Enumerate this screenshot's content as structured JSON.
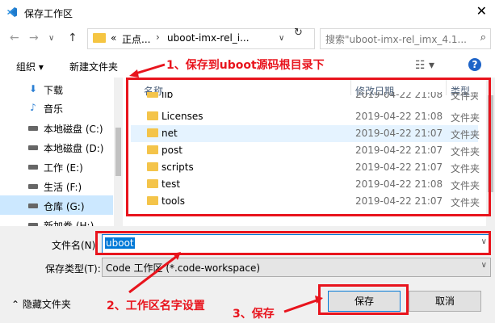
{
  "window": {
    "title": "保存工作区",
    "close_glyph": "✕",
    "app_icon": "vscode-icon"
  },
  "nav": {
    "back_glyph": "←",
    "forward_glyph": "→",
    "recent_glyph": "∨",
    "up_glyph": "↑",
    "breadcrumb": [
      "«",
      "正点...",
      "uboot-imx-rel_i..."
    ],
    "breadcrumb_sep": "›",
    "crumb_dropdown": "∨",
    "refresh_glyph": "↻",
    "search_placeholder": "搜索\"uboot-imx-rel_imx_4.1...",
    "search_glyph": "⌕"
  },
  "toolbar": {
    "organize": "组织 ▾",
    "new_folder": "新建文件夹",
    "view_glyph": "☷ ▾",
    "help": "?"
  },
  "sidebar": {
    "items": [
      {
        "label": "下载",
        "icon": "download-icon",
        "glyph": "⬇"
      },
      {
        "label": "音乐",
        "icon": "music-icon",
        "glyph": "♪"
      },
      {
        "label": "本地磁盘 (C:)",
        "icon": "drive-icon",
        "glyph": ""
      },
      {
        "label": "本地磁盘 (D:)",
        "icon": "drive-icon",
        "glyph": ""
      },
      {
        "label": "工作 (E:)",
        "icon": "drive-icon",
        "glyph": ""
      },
      {
        "label": "生活 (F:)",
        "icon": "drive-icon",
        "glyph": ""
      },
      {
        "label": "仓库 (G:)",
        "icon": "drive-icon",
        "glyph": ""
      },
      {
        "label": "新加卷 (H:)",
        "icon": "drive-icon",
        "glyph": ""
      }
    ],
    "selected_index": 6
  },
  "filelist": {
    "columns": {
      "name": "名称",
      "modified": "修改日期",
      "type": "类型"
    },
    "rows": [
      {
        "name": "lib",
        "modified": "2019-04-22 21:08",
        "type": "文件夹"
      },
      {
        "name": "Licenses",
        "modified": "2019-04-22 21:08",
        "type": "文件夹"
      },
      {
        "name": "net",
        "modified": "2019-04-22 21:07",
        "type": "文件夹"
      },
      {
        "name": "post",
        "modified": "2019-04-22 21:07",
        "type": "文件夹"
      },
      {
        "name": "scripts",
        "modified": "2019-04-22 21:07",
        "type": "文件夹"
      },
      {
        "name": "test",
        "modified": "2019-04-22 21:08",
        "type": "文件夹"
      },
      {
        "name": "tools",
        "modified": "2019-04-22 21:07",
        "type": "文件夹"
      }
    ]
  },
  "form": {
    "filename_label": "文件名(N):",
    "filename_value": "uboot",
    "filetype_label": "保存类型(T):",
    "filetype_value": "Code 工作区 (*.code-workspace)",
    "dropdown_glyph": "∨",
    "hide_folders": "⌃  隐藏文件夹",
    "save_button": "保存",
    "cancel_button": "取消"
  },
  "annotations": {
    "step1": "1、保存到uboot源码根目录下",
    "step2": "2、工作区名字设置",
    "step3": "3、保存",
    "color": "#e8141d"
  }
}
